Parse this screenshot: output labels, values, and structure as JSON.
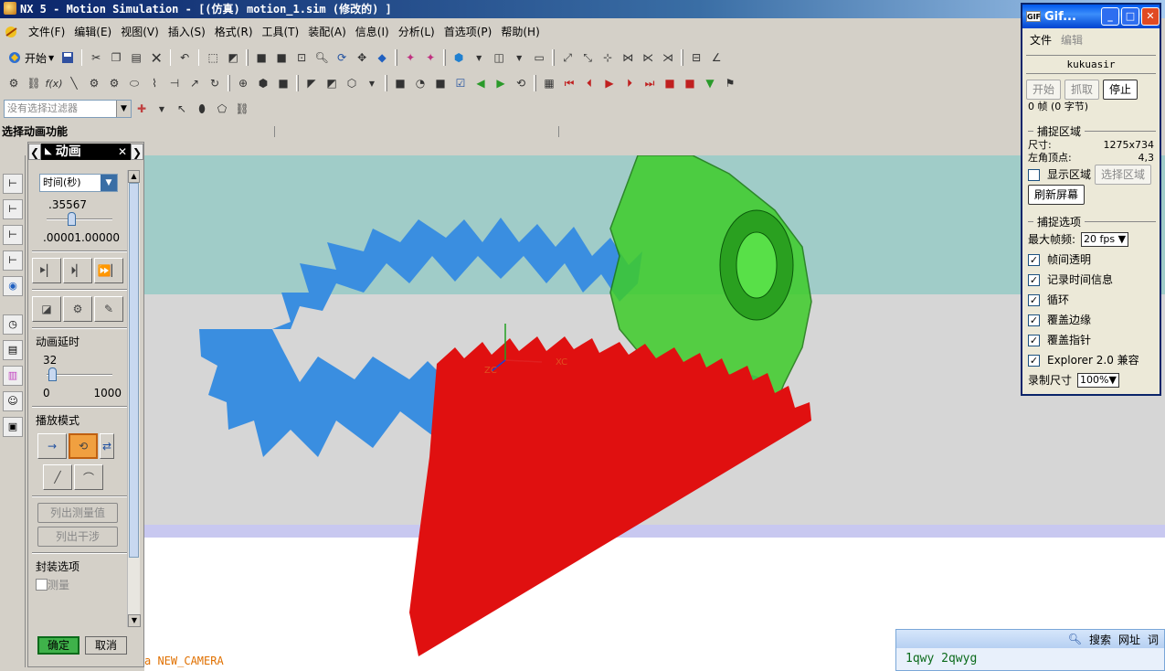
{
  "window": {
    "title": "NX 5 - Motion Simulation - [(仿真) motion_1.sim  (修改的) ]"
  },
  "menu": [
    "文件(F)",
    "编辑(E)",
    "视图(V)",
    "插入(S)",
    "格式(R)",
    "工具(T)",
    "装配(A)",
    "信息(I)",
    "分析(L)",
    "首选项(P)",
    "帮助(H)"
  ],
  "toolbar": {
    "start_label": "开始",
    "filter_placeholder": "没有选择过滤器"
  },
  "cue_line": "选择动画功能",
  "anim_dialog": {
    "title": "动画",
    "time_unit": "时间(秒)",
    "time_value": ".35567",
    "time_range": ".00001.00000",
    "delay_label": "动画延时",
    "delay_value": "32",
    "delay_min": "0",
    "delay_max": "1000",
    "playback_mode_label": "播放模式",
    "list_measure": "列出测量值",
    "list_interference": "列出干涉",
    "envelope_label": "封装选项",
    "measure_label": "测量",
    "ok": "确定",
    "cancel": "取消",
    "time_fraction": 0.36,
    "delay_fraction": 0.032
  },
  "viewport": {
    "camera": "a NEW_CAMERA",
    "axis_x": "XC",
    "axis_z": "ZC",
    "colors": {
      "sky": "#a0ccc8",
      "floor": "#d6d6d6",
      "ring_gear": "#3a8ee0",
      "pinion": "#3ecc2a",
      "rack": "#e01010"
    }
  },
  "gif_window": {
    "title": "Gif...",
    "menu_file": "文件",
    "menu_edit": "编辑",
    "name": "kukuasir",
    "btn_start": "开始",
    "btn_capture": "抓取",
    "btn_stop": "停止",
    "frames": "0 帧 (0 字节)",
    "capture_area": "捕捉区域",
    "size_label": "尺寸:",
    "size_value": "1275x734",
    "corner_label": "左角顶点:",
    "corner_value": "4,3",
    "show_area": "显示区域",
    "select_area": "选择区域",
    "refresh": "刷新屏幕",
    "capture_options": "捕捉选项",
    "max_fps_label": "最大帧频:",
    "max_fps_value": "20 fps",
    "opt_transparent": "帧间透明",
    "opt_timeinfo": "记录时间信息",
    "opt_loop": "循环",
    "opt_border": "覆盖边缘",
    "opt_pointer": "覆盖指针",
    "opt_explorer": "Explorer 2.0 兼容",
    "record_size_label": "录制尺寸",
    "record_size_value": "100%"
  },
  "search_widget": {
    "search": "搜索",
    "url": "网址",
    "word": "词",
    "text": "1qwy 2qwyg"
  }
}
